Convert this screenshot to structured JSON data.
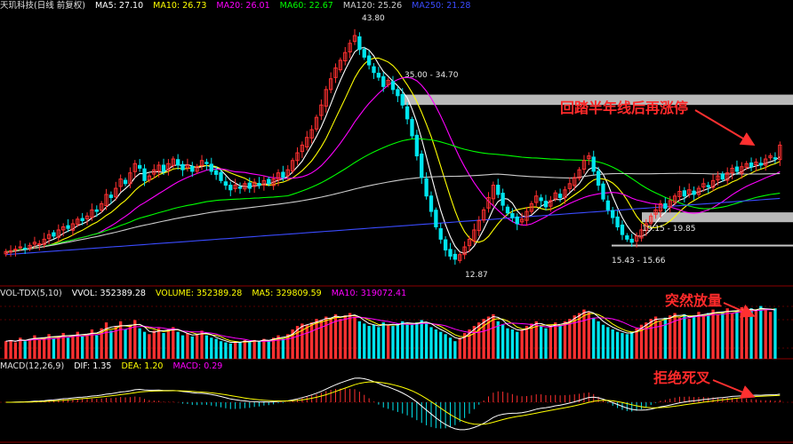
{
  "price_header": {
    "title": "天玑科技(日线 前复权)",
    "ma": [
      {
        "label": "MA5: 27.10",
        "color": "#ffffff"
      },
      {
        "label": "MA10: 26.73",
        "color": "#ffff00"
      },
      {
        "label": "MA20: 26.01",
        "color": "#ff00ff"
      },
      {
        "label": "MA60: 22.67",
        "color": "#00ff00"
      },
      {
        "label": "MA120: 25.26",
        "color": "#cccccc"
      },
      {
        "label": "MA250: 21.28",
        "color": "#3a4bff"
      }
    ]
  },
  "vol_header": {
    "title": "VOL-TDX(5,10)",
    "items": [
      {
        "label": "VVOL: 352389.28",
        "color": "#ffffff"
      },
      {
        "label": "VOLUME: 352389.28",
        "color": "#ffff00"
      },
      {
        "label": "MA5: 329809.59",
        "color": "#ffff00"
      },
      {
        "label": "MA10: 319072.41",
        "color": "#ff00ff"
      }
    ]
  },
  "macd_header": {
    "title": "MACD(12,26,9)",
    "items": [
      {
        "label": "DIF: 1.35",
        "color": "#ffffff"
      },
      {
        "label": "DEA: 1.20",
        "color": "#ffff00"
      },
      {
        "label": "MACD: 0.29",
        "color": "#ff00ff"
      }
    ]
  },
  "annotations": {
    "ann1": "回踏半年线后再涨停",
    "ann2": "突然放量",
    "ann3": "拒绝死叉"
  },
  "price_labels": {
    "high": "43.80",
    "low": "12.87",
    "zone1": "35.00 - 34.70",
    "zone2": "19.15 - 19.85",
    "zone3": "15.43 - 15.66"
  },
  "colors": {
    "up": "#ff3030",
    "down": "#00e5ee",
    "bg": "#000000",
    "grid": "#8b0000"
  },
  "chart_data": [
    {
      "type": "candlestick",
      "title": "天玑科技(日线 前复权)",
      "ylim": [
        11,
        46
      ],
      "zones": [
        [
          34.7,
          35.0
        ],
        [
          19.15,
          19.85
        ],
        [
          15.43,
          15.66
        ]
      ],
      "close": [
        15.0,
        15.1,
        15.3,
        15.6,
        15.4,
        15.8,
        16.2,
        16.0,
        16.6,
        17.2,
        17.0,
        17.8,
        18.2,
        18.0,
        18.6,
        19.2,
        19.0,
        19.6,
        20.4,
        20.2,
        21.2,
        22.4,
        22.0,
        23.2,
        24.4,
        23.8,
        25.2,
        26.4,
        25.8,
        24.2,
        24.8,
        25.6,
        26.2,
        25.4,
        26.4,
        27.0,
        26.2,
        25.6,
        26.2,
        25.4,
        26.0,
        26.8,
        26.4,
        25.4,
        25.0,
        24.2,
        23.6,
        23.0,
        23.6,
        23.2,
        23.8,
        23.2,
        24.0,
        23.6,
        24.2,
        23.8,
        24.4,
        25.2,
        24.6,
        25.6,
        26.8,
        27.8,
        28.8,
        29.8,
        30.8,
        32.4,
        34.0,
        36.0,
        37.4,
        38.8,
        39.8,
        40.8,
        42.0,
        43.0,
        41.2,
        40.2,
        39.2,
        38.2,
        37.6,
        36.4,
        37.2,
        36.0,
        35.2,
        34.0,
        32.2,
        30.0,
        27.4,
        24.6,
        22.2,
        20.2,
        18.2,
        16.6,
        15.2,
        14.4,
        14.0,
        14.6,
        15.6,
        16.6,
        17.8,
        19.0,
        20.4,
        22.0,
        23.6,
        22.4,
        21.0,
        20.0,
        19.4,
        18.6,
        19.2,
        20.2,
        21.2,
        22.2,
        21.6,
        20.8,
        21.6,
        22.6,
        22.0,
        23.0,
        23.8,
        24.6,
        25.6,
        26.8,
        27.4,
        25.4,
        23.6,
        21.8,
        20.4,
        19.4,
        18.2,
        17.2,
        16.6,
        16.2,
        17.0,
        17.8,
        18.6,
        19.6,
        20.4,
        21.2,
        20.6,
        21.6,
        22.2,
        22.8,
        22.2,
        23.0,
        22.4,
        23.2,
        23.8,
        23.4,
        24.2,
        24.8,
        24.4,
        25.2,
        25.8,
        25.4,
        26.0,
        26.4,
        26.0,
        26.6,
        26.2,
        27.0,
        27.4,
        27.0,
        28.8
      ],
      "ma_series": [
        {
          "name": "MA5",
          "period": 5,
          "color": "#ffffff"
        },
        {
          "name": "MA10",
          "period": 10,
          "color": "#ffff00"
        },
        {
          "name": "MA20",
          "period": 20,
          "color": "#ff00ff"
        },
        {
          "name": "MA60",
          "period": 60,
          "color": "#00ff00"
        },
        {
          "name": "MA120",
          "period": 120,
          "color": "#cccccc"
        },
        {
          "name": "MA250",
          "period": 250,
          "color": "#3a4bff"
        }
      ]
    },
    {
      "type": "bar",
      "title": "VOL-TDX(5,10)",
      "ylim": [
        0,
        1
      ],
      "values": [
        0.3,
        0.32,
        0.28,
        0.36,
        0.3,
        0.34,
        0.4,
        0.32,
        0.36,
        0.42,
        0.35,
        0.38,
        0.44,
        0.36,
        0.4,
        0.46,
        0.38,
        0.42,
        0.5,
        0.4,
        0.52,
        0.62,
        0.48,
        0.56,
        0.64,
        0.5,
        0.58,
        0.66,
        0.52,
        0.46,
        0.42,
        0.48,
        0.52,
        0.44,
        0.5,
        0.54,
        0.46,
        0.4,
        0.44,
        0.38,
        0.42,
        0.48,
        0.4,
        0.36,
        0.34,
        0.3,
        0.28,
        0.26,
        0.3,
        0.28,
        0.32,
        0.28,
        0.32,
        0.3,
        0.34,
        0.3,
        0.36,
        0.4,
        0.34,
        0.42,
        0.5,
        0.56,
        0.6,
        0.58,
        0.62,
        0.68,
        0.66,
        0.72,
        0.7,
        0.76,
        0.68,
        0.74,
        0.78,
        0.72,
        0.64,
        0.6,
        0.56,
        0.58,
        0.54,
        0.62,
        0.58,
        0.56,
        0.6,
        0.64,
        0.6,
        0.58,
        0.62,
        0.66,
        0.6,
        0.54,
        0.5,
        0.46,
        0.42,
        0.36,
        0.3,
        0.36,
        0.44,
        0.5,
        0.56,
        0.62,
        0.68,
        0.72,
        0.76,
        0.64,
        0.58,
        0.52,
        0.5,
        0.46,
        0.5,
        0.56,
        0.6,
        0.64,
        0.56,
        0.52,
        0.58,
        0.62,
        0.56,
        0.64,
        0.68,
        0.74,
        0.78,
        0.84,
        0.8,
        0.7,
        0.64,
        0.58,
        0.54,
        0.5,
        0.46,
        0.44,
        0.42,
        0.46,
        0.52,
        0.58,
        0.62,
        0.68,
        0.72,
        0.64,
        0.7,
        0.74,
        0.78,
        0.7,
        0.76,
        0.68,
        0.74,
        0.8,
        0.72,
        0.78,
        0.84,
        0.76,
        0.8,
        0.86,
        0.78,
        0.82,
        0.88,
        0.8,
        0.86,
        0.82,
        0.9,
        0.84,
        0.8,
        0.86
      ]
    },
    {
      "type": "bar",
      "title": "MACD(12,26,9)",
      "ylim": [
        -5,
        5
      ],
      "series": [
        {
          "name": "DIF",
          "color": "#ffffff"
        },
        {
          "name": "DEA",
          "color": "#ffff00"
        },
        {
          "name": "MACD",
          "color": "#ff00ff"
        }
      ]
    }
  ]
}
